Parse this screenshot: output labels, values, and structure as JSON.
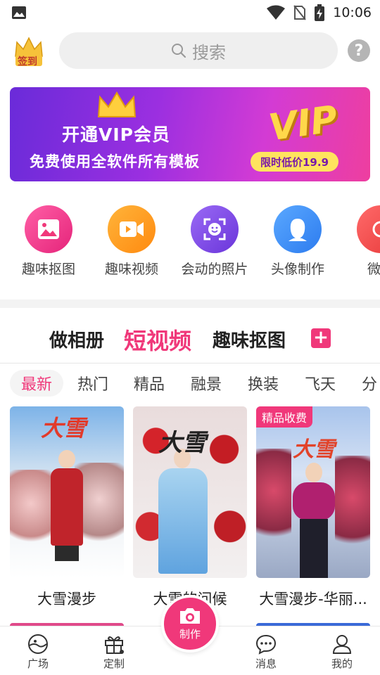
{
  "status_bar": {
    "time": "10:06"
  },
  "header": {
    "signin_label": "签到",
    "search_placeholder": "搜索",
    "help_label": "?"
  },
  "banner": {
    "line1": "开通VIP会员",
    "line2": "免费使用全软件所有模板",
    "vip_text": "VIP",
    "price_label": "限时低价19.9"
  },
  "features": [
    {
      "label": "趣味抠图",
      "icon": "image-icon",
      "color": "#f0387a"
    },
    {
      "label": "趣味视频",
      "icon": "video-camera-icon",
      "color": "#ff9a1f"
    },
    {
      "label": "会动的照片",
      "icon": "face-scan-icon",
      "color": "#7b4ae6"
    },
    {
      "label": "头像制作",
      "icon": "avatar-icon",
      "color": "#3d8ff5"
    },
    {
      "label": "微信",
      "icon": "partial-icon",
      "color": "#f04b4b"
    }
  ],
  "section_tabs": [
    {
      "label": "做相册"
    },
    {
      "label": "短视频"
    },
    {
      "label": "趣味抠图"
    }
  ],
  "section_plus": "+",
  "chips": [
    "最新",
    "热门",
    "精品",
    "融景",
    "换装",
    "飞天",
    "分"
  ],
  "cards": [
    {
      "title": "大雪漫步",
      "art": "大雪",
      "badge": ""
    },
    {
      "title": "大雪的问候",
      "art": "大雪",
      "badge": ""
    },
    {
      "title": "大雪漫步-华丽...",
      "art": "大雪",
      "badge": "精品收费"
    }
  ],
  "bottom_nav": {
    "plaza": "广场",
    "custom": "定制",
    "make": "制作",
    "messages": "消息",
    "mine": "我的"
  },
  "colors": {
    "accent": "#f0387a"
  }
}
